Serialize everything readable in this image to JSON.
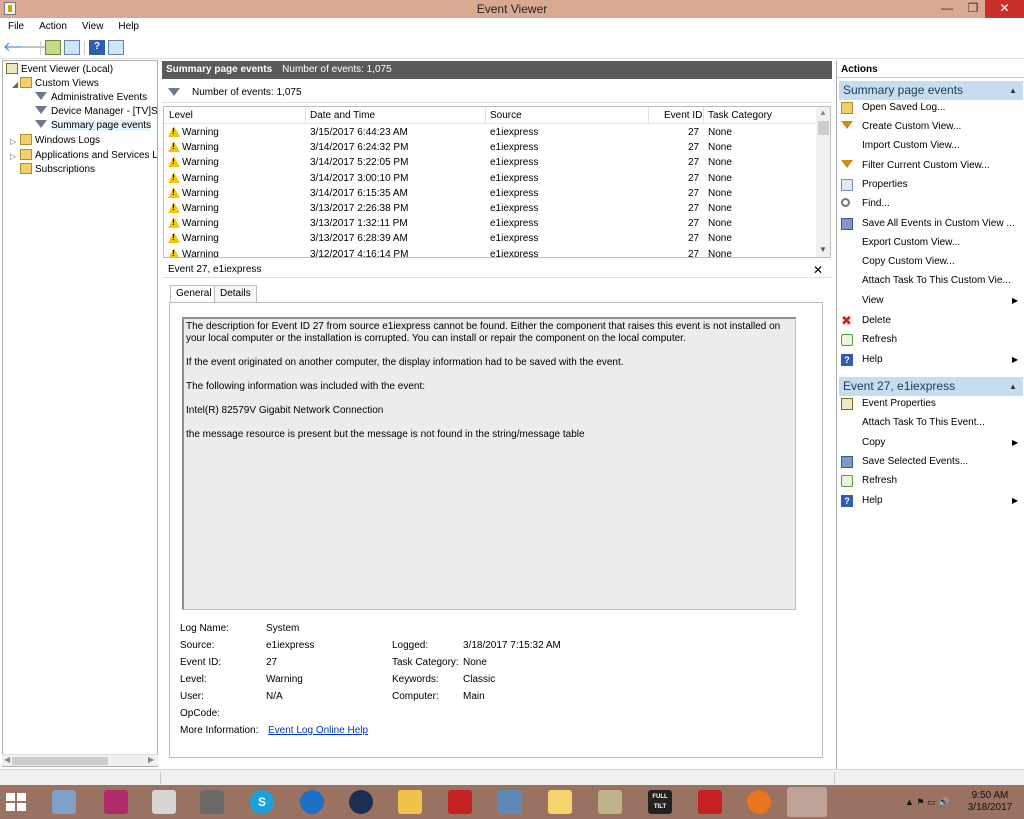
{
  "window": {
    "title": "Event Viewer",
    "minimize": "—",
    "maximize": "❐",
    "close": "✕"
  },
  "menu": [
    "File",
    "Action",
    "View",
    "Help"
  ],
  "toolbar": {
    "back": "🡐",
    "forward": "🡒",
    "help": "?"
  },
  "tree": {
    "root": "Event Viewer (Local)",
    "custom_views": "Custom Views",
    "administrative_events": "Administrative Events",
    "device_manager": "Device Manager - [TV]Sa",
    "summary_page_events": "Summary page events",
    "windows_logs": "Windows Logs",
    "apps_services": "Applications and Services Lo",
    "subscriptions": "Subscriptions"
  },
  "center": {
    "header_name": "Summary page events",
    "header_count": "Number of events: 1,075",
    "filter_text": "Number of events: 1,075",
    "columns": [
      "Level",
      "Date and Time",
      "Source",
      "Event ID",
      "Task Category"
    ],
    "rows": [
      {
        "level": "Warning",
        "date": "3/15/2017 6:44:23 AM",
        "source": "e1iexpress",
        "id": "27",
        "task": "None"
      },
      {
        "level": "Warning",
        "date": "3/14/2017 6:24:32 PM",
        "source": "e1iexpress",
        "id": "27",
        "task": "None"
      },
      {
        "level": "Warning",
        "date": "3/14/2017 5:22:05 PM",
        "source": "e1iexpress",
        "id": "27",
        "task": "None"
      },
      {
        "level": "Warning",
        "date": "3/14/2017 3:00:10 PM",
        "source": "e1iexpress",
        "id": "27",
        "task": "None"
      },
      {
        "level": "Warning",
        "date": "3/14/2017 6:15:35 AM",
        "source": "e1iexpress",
        "id": "27",
        "task": "None"
      },
      {
        "level": "Warning",
        "date": "3/13/2017 2:26:38 PM",
        "source": "e1iexpress",
        "id": "27",
        "task": "None"
      },
      {
        "level": "Warning",
        "date": "3/13/2017 1:32:11 PM",
        "source": "e1iexpress",
        "id": "27",
        "task": "None"
      },
      {
        "level": "Warning",
        "date": "3/13/2017 6:28:39 AM",
        "source": "e1iexpress",
        "id": "27",
        "task": "None"
      },
      {
        "level": "Warning",
        "date": "3/12/2017 4:16:14 PM",
        "source": "e1iexpress",
        "id": "27",
        "task": "None"
      }
    ]
  },
  "detail": {
    "title": "Event 27, e1iexpress",
    "close": "✕",
    "tabs": [
      "General",
      "Details"
    ],
    "description": [
      "The description for Event ID 27 from source e1iexpress cannot be found. Either the component that raises this event is not installed on your local computer or the installation is corrupted. You can install or repair the component on the local computer.",
      "If the event originated on another computer, the display information had to be saved with the event.",
      "The following information was included with the event:",
      "Intel(R) 82579V Gigabit Network Connection",
      "the message resource is present but the message is not found in the string/message table"
    ],
    "props": {
      "log_name_label": "Log Name:",
      "log_name": "System",
      "source_label": "Source:",
      "source": "e1iexpress",
      "logged_label": "Logged:",
      "logged": "3/18/2017 7:15:32 AM",
      "event_id_label": "Event ID:",
      "event_id": "27",
      "task_category_label": "Task Category:",
      "task_category": "None",
      "level_label": "Level:",
      "level": "Warning",
      "keywords_label": "Keywords:",
      "keywords": "Classic",
      "user_label": "User:",
      "user": "N/A",
      "computer_label": "Computer:",
      "computer": "Main",
      "opcode_label": "OpCode:",
      "opcode": "",
      "more_info_label": "More Information:",
      "more_info_link": "Event Log Online Help"
    }
  },
  "actions": {
    "title": "Actions",
    "section1": "Summary page events",
    "section1_items": [
      "Open Saved Log...",
      "Create Custom View...",
      "Import Custom View...",
      "Filter Current Custom View...",
      "Properties",
      "Find...",
      "Save All Events in Custom View ...",
      "Export Custom View...",
      "Copy Custom View...",
      "Attach Task To This Custom Vie...",
      "View",
      "Delete",
      "Refresh",
      "Help"
    ],
    "section2": "Event 27, e1iexpress",
    "section2_items": [
      "Event Properties",
      "Attach Task To This Event...",
      "Copy",
      "Save Selected Events...",
      "Refresh",
      "Help"
    ]
  },
  "taskbar": {
    "time": "9:50 AM",
    "date": "3/18/2017",
    "skype": "S",
    "fulltilt": "FULL TILT"
  }
}
